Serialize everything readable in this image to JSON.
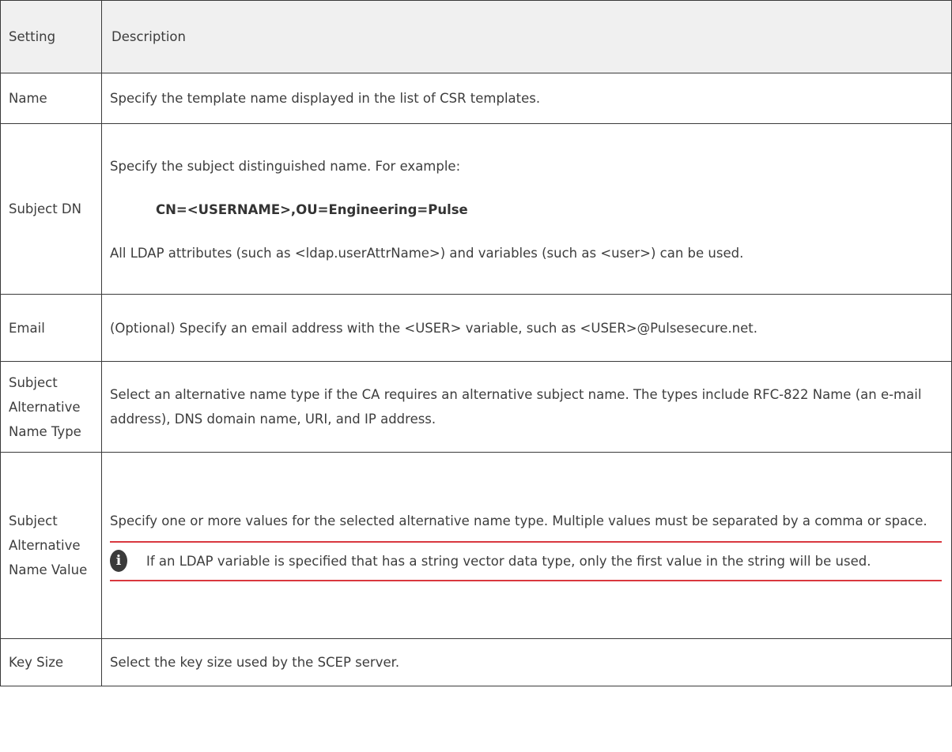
{
  "table": {
    "headers": {
      "setting": "Setting",
      "description": "Description"
    },
    "rows": {
      "name": {
        "setting": "Name",
        "description": "Specify the template name displayed in the list of CSR templates."
      },
      "subject_dn": {
        "setting": "Subject DN",
        "description": "Specify the subject distinguished name. For example:",
        "example": "CN=<USERNAME>,OU=Engineering=Pulse",
        "extra": "All LDAP attributes (such as <ldap.userAttrName>) and variables (such as <user>) can be used."
      },
      "email": {
        "setting": "Email",
        "description": "(Optional) Specify an email address with the <USER> variable, such as <USER>@Pulsesecure.net."
      },
      "san_type": {
        "setting": "Subject Alternative Name Type",
        "description": "Select an alternative name type if the CA requires an alternative subject name. The types include RFC-822 Name (an e-mail address), DNS domain name, URI, and IP address."
      },
      "san_value": {
        "setting": "Subject Alternative Name Value",
        "description": "Specify one or more values for the selected alternative name type. Multiple values must be separated by a comma or space.",
        "note": "If an LDAP variable is specified that has a string vector data type, only the first value in the string will be used.",
        "note_icon": "info-icon"
      },
      "key_size": {
        "setting": "Key Size",
        "description": "Select the key size used by the SCEP server."
      }
    }
  },
  "colors": {
    "header_bg": "#f0f0f0",
    "note_rule": "#d9383f",
    "icon_bg": "#3b3b3b"
  }
}
